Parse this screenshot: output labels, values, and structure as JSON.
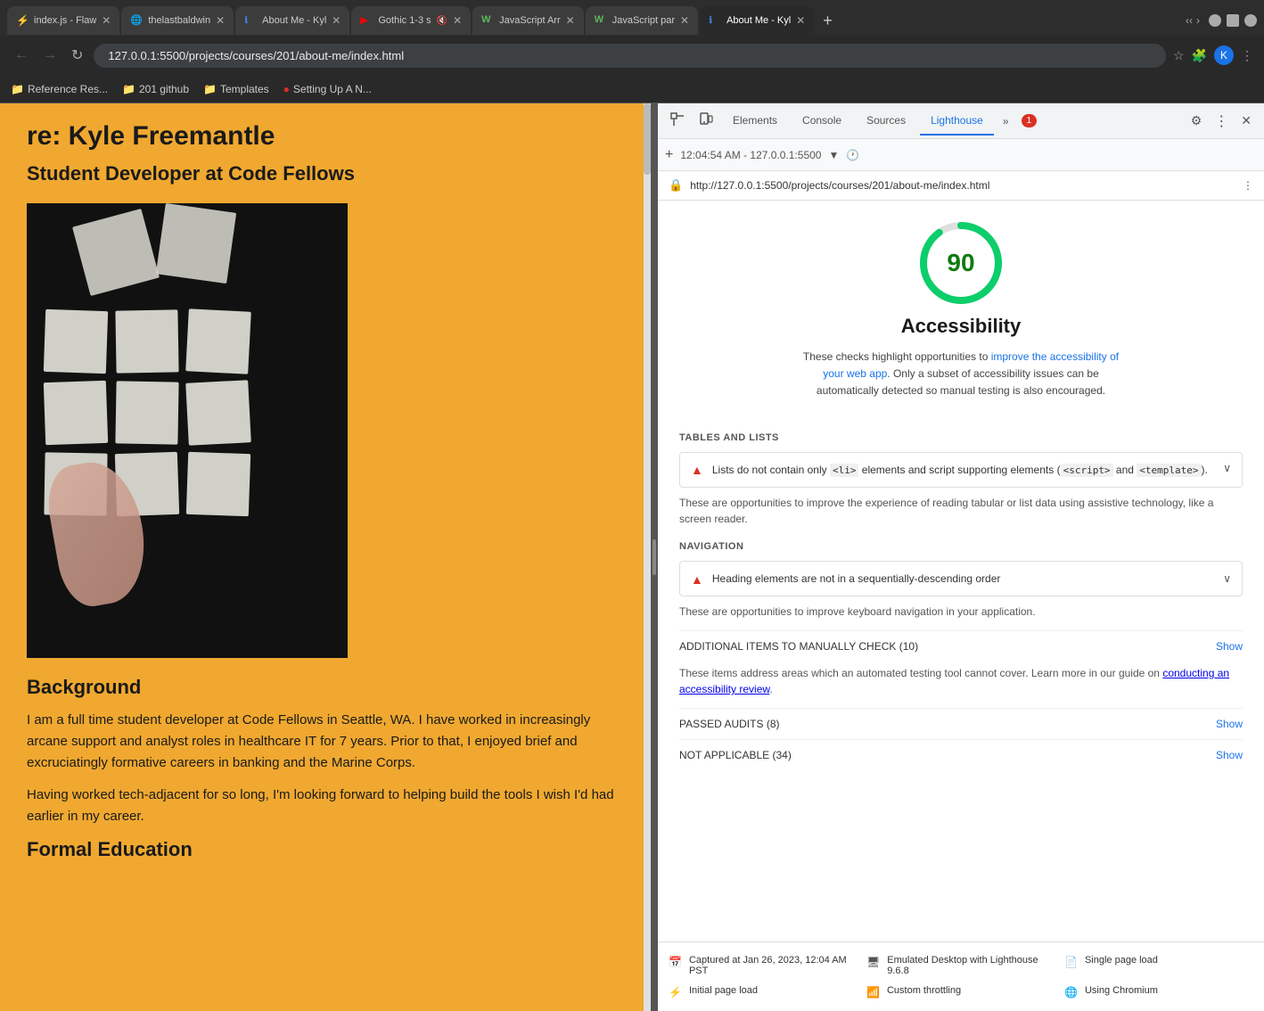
{
  "browser": {
    "tabs": [
      {
        "id": "tab1",
        "favicon": "⚡",
        "title": "index.js - Flaw",
        "active": false,
        "closable": true
      },
      {
        "id": "tab2",
        "favicon": "🌐",
        "title": "thelastbaldwin",
        "active": false,
        "closable": true
      },
      {
        "id": "tab3",
        "favicon": "ℹ️",
        "title": "About Me - Kyl",
        "active": false,
        "closable": true
      },
      {
        "id": "tab4",
        "favicon": "▶",
        "title": "Gothic 1-3 s",
        "active": false,
        "closable": true,
        "muted": true
      },
      {
        "id": "tab5",
        "favicon": "W",
        "title": "JavaScript Arr",
        "active": false,
        "closable": true
      },
      {
        "id": "tab6",
        "favicon": "W",
        "title": "JavaScript par",
        "active": false,
        "closable": true
      },
      {
        "id": "tab7",
        "favicon": "ℹ️",
        "title": "About Me - Kyl",
        "active": true,
        "closable": true
      }
    ],
    "address": "127.0.0.1:5500/projects/courses/201/about-me/index.html",
    "bookmarks": [
      {
        "icon": "📁",
        "label": "Reference Res..."
      },
      {
        "icon": "📁",
        "label": "201 github"
      },
      {
        "icon": "📁",
        "label": "Templates"
      },
      {
        "icon": "🔴",
        "label": "Setting Up A N..."
      }
    ]
  },
  "page": {
    "name": "re: Kyle Freemantle",
    "subtitle": "Student Developer at Code Fellows",
    "background_section_title": "Background",
    "body_text_1": "I am a full time student developer at Code Fellows in Seattle, WA. I have worked in increasingly arcane support and analyst roles in healthcare IT for 7 years. Prior to that, I enjoyed brief and excruciatingly formative careers in banking and the Marine Corps.",
    "body_text_2": "Having worked tech-adjacent for so long, I'm looking forward to helping build the tools I wish I'd had earlier in my career.",
    "formal_education_title": "Formal Education"
  },
  "devtools": {
    "tabs": [
      "Elements",
      "Console",
      "Sources",
      "Lighthouse"
    ],
    "active_tab": "Lighthouse",
    "error_count": 1,
    "timestamp": "12:04:54 AM - 127.0.0.1:5500",
    "url": "http://127.0.0.1:5500/projects/courses/201/about-me/index.html"
  },
  "lighthouse": {
    "score": 90,
    "title": "Accessibility",
    "description_part1": "These checks highlight opportunities to ",
    "description_link": "improve the accessibility of your web app",
    "description_part2": ". Only a subset of accessibility issues can be automatically detected so manual testing is also encouraged.",
    "sections": {
      "tables_and_lists": {
        "label": "TABLES AND LISTS",
        "items": [
          {
            "icon": "warning",
            "text_before_code1": "Lists do not contain only ",
            "code1": "<li>",
            "text_middle": " elements and script supporting elements (",
            "code2": "<script>",
            "text_before_code3": " and ",
            "code3": "<template>",
            "text_after": ").",
            "expanded": true
          }
        ],
        "opportunity_text": "These are opportunities to improve the experience of reading tabular or list data using assistive technology, like a screen reader."
      },
      "navigation": {
        "label": "NAVIGATION",
        "items": [
          {
            "icon": "warning",
            "text": "Heading elements are not in a sequentially-descending order"
          }
        ],
        "opportunity_text": "These are opportunities to improve keyboard navigation in your application."
      },
      "additional_items": {
        "label": "ADDITIONAL ITEMS TO MANUALLY CHECK",
        "count": 10,
        "show_label": "Show"
      },
      "additional_desc": "These items address areas which an automated testing tool cannot cover. Learn more in our guide on ",
      "additional_link": "conducting an accessibility review",
      "additional_desc_end": ".",
      "passed_audits": {
        "label": "PASSED AUDITS",
        "count": 8,
        "show_label": "Show"
      },
      "not_applicable": {
        "label": "NOT APPLICABLE",
        "count": 34,
        "show_label": "Show"
      }
    },
    "footer": {
      "items": [
        {
          "icon": "📅",
          "text": "Captured at Jan 26, 2023, 12:04 AM PST"
        },
        {
          "icon": "🖥️",
          "text": "Emulated Desktop with Lighthouse 9.6.8"
        },
        {
          "icon": "📄",
          "text": "Single page load"
        }
      ],
      "items2": [
        {
          "icon": "⚡",
          "text": "Initial page load"
        },
        {
          "icon": "📶",
          "text": "Custom throttling"
        },
        {
          "icon": "🌐",
          "text": "Using Chromium"
        }
      ]
    }
  }
}
